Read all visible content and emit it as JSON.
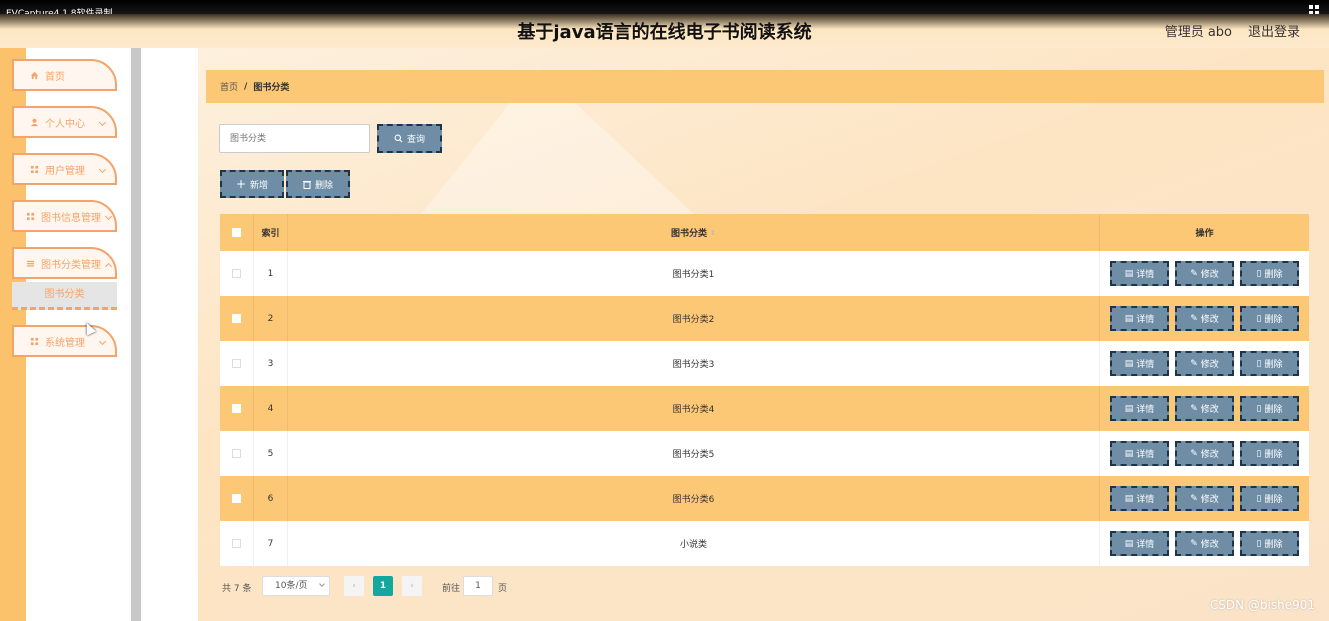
{
  "capture_bar": {
    "title": "EVCapture4.1.8软件录制"
  },
  "header": {
    "title": "基于java语言的在线电子书阅读系统",
    "user": "管理员 abo",
    "logout": "退出登录"
  },
  "sidebar": {
    "items": [
      {
        "label": "首页",
        "icon": "home-icon"
      },
      {
        "label": "个人中心",
        "icon": "user-icon"
      },
      {
        "label": "用户管理",
        "icon": "grid-icon"
      },
      {
        "label": "图书信息管理",
        "icon": "grid-icon"
      },
      {
        "label": "图书分类管理",
        "icon": "list-icon"
      },
      {
        "label": "系统管理",
        "icon": "grid-icon"
      }
    ],
    "sub_item": "图书分类"
  },
  "breadcrumb": {
    "home": "首页",
    "sep": "/",
    "current": "图书分类"
  },
  "search": {
    "placeholder": "图书分类",
    "button": "查询"
  },
  "toolbar": {
    "add": "新增",
    "delete": "删除"
  },
  "table": {
    "headers": {
      "index": "索引",
      "name": "图书分类",
      "ops": "操作"
    },
    "rows": [
      {
        "index": "1",
        "name": "图书分类1"
      },
      {
        "index": "2",
        "name": "图书分类2"
      },
      {
        "index": "3",
        "name": "图书分类3"
      },
      {
        "index": "4",
        "name": "图书分类4"
      },
      {
        "index": "5",
        "name": "图书分类5"
      },
      {
        "index": "6",
        "name": "图书分类6"
      },
      {
        "index": "7",
        "name": "小说类"
      }
    ],
    "ops": {
      "detail": "详情",
      "edit": "修改",
      "delete": "删除"
    }
  },
  "pagination": {
    "total": "共 7 条",
    "page_size": "10条/页",
    "current_page": "1",
    "goto_label": "前往",
    "goto_value": "1",
    "page_word": "页"
  },
  "watermark": "CSDN @bishe901",
  "colors": {
    "accent": "#fdc875",
    "button": "#6f8ea6",
    "active_page": "#13a89e"
  }
}
